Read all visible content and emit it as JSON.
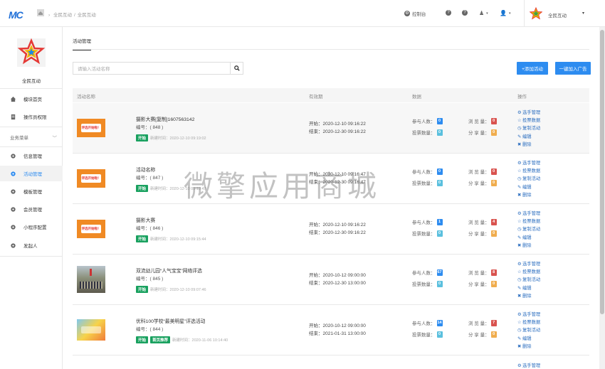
{
  "header": {
    "logo": "MC",
    "breadcrumb": [
      "全民互动",
      "/",
      "全民互动"
    ],
    "console": "控制台",
    "user": "全民互动"
  },
  "sidebar": {
    "name": "全民互动",
    "top_items": [
      "模块首页",
      "操作员权限"
    ],
    "group": "业务菜单",
    "group_items": [
      "信息管理",
      "活动管理",
      "模板管理",
      "会员管理",
      "小程序配置",
      "发起人"
    ]
  },
  "main": {
    "tab": "活动管理",
    "search_placeholder": "请输入活动名称",
    "add_button": "+添加活动",
    "ad_button": "一键加入广告",
    "columns": [
      "活动名称",
      "有效期",
      "数据",
      "操作"
    ],
    "rows": [
      {
        "title": "摄影大赛[复制]1607563142",
        "num": "编号：( 848 )",
        "badges": [
          "开始"
        ],
        "created": "新建时间：2020-12-10 09:19:02",
        "start": "开始：2020-12-10 09:16:22",
        "end": "结束：2020-12-30 09:16:22",
        "participants": "0",
        "votes": "0",
        "views": "0",
        "shares": "0",
        "thumb": "评选开始啦！"
      },
      {
        "title": "活动名称",
        "num": "编号：( 847 )",
        "badges": [
          "开始"
        ],
        "created": "新建时间：2020-12-10 09:19:47",
        "start": "开始：2020-12-10 09:16:47",
        "end": "结束：2020-12-30 09:16:47",
        "participants": "0",
        "votes": "0",
        "views": "0",
        "shares": "0",
        "thumb": "评选开始啦！"
      },
      {
        "title": "摄影大赛",
        "num": "编号：( 846 )",
        "badges": [
          "开始"
        ],
        "created": "新建时间：2020-12-10 09:15:44",
        "start": "开始：2020-12-10 09:16:22",
        "end": "结束：2020-12-30 09:16:22",
        "participants": "1",
        "votes": "0",
        "views": "4",
        "shares": "0",
        "thumb": "评选开始啦！"
      },
      {
        "title": "双流幼儿园“人气宝宝”网络评选",
        "num": "编号：( 845 )",
        "badges": [
          "开始"
        ],
        "created": "新建时间：2020-12-10 09:07:46",
        "start": "开始：2020-10-12 09:00:00",
        "end": "结束：2020-12-30 13:00:00",
        "participants": "67",
        "votes": "0",
        "views": "8",
        "shares": "0",
        "thumb": ""
      },
      {
        "title": "优科100学校“最美明星”评选活动",
        "num": "编号：( 844 )",
        "badges": [
          "开始",
          "首页推荐"
        ],
        "created": "新建时间：2020-11-06 10:14:40",
        "start": "开始：2020-10-12 09:00:00",
        "end": "结束：2021-01-31 13:00:00",
        "participants": "14",
        "votes": "0",
        "views": "7",
        "shares": "0",
        "thumb": ""
      }
    ],
    "labels": {
      "participants": "参与人数：",
      "votes": "投票数量：",
      "views": "浏 览 量：",
      "shares": "分 享 量："
    },
    "ops": [
      "选手管理",
      "投票数据",
      "复制活动",
      "编辑",
      "删除"
    ],
    "next_row_op": "选手管理"
  },
  "watermark": "微擎应用商城",
  "colors": {
    "accent": "#2d8cf0",
    "start_badge": "#19a15f"
  }
}
